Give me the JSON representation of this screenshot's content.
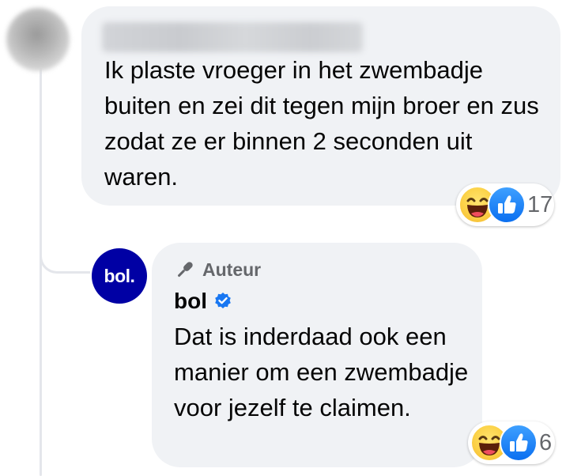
{
  "comment": {
    "text": "Ik plaste vroeger in het zwembadje buiten en zei dit tegen mijn broer en zus zodat ze er binnen 2 seconden uit waren.",
    "reactions": {
      "icons": [
        "haha-emoji-icon",
        "like-thumb-icon"
      ],
      "count": "17"
    }
  },
  "reply": {
    "badge_label": "Auteur",
    "author_name": "bol",
    "avatar_text": "bol.",
    "text": "Dat is inderdaad ook een manier om een zwembadje voor jezelf te claimen.",
    "reactions": {
      "icons": [
        "haha-emoji-icon",
        "like-thumb-icon"
      ],
      "count": "6"
    }
  },
  "colors": {
    "bubble": "#f0f2f5",
    "bol_brand": "#0000a4",
    "verified": "#1877f2",
    "like": "#1877f2",
    "secondary_text": "#65676b"
  }
}
